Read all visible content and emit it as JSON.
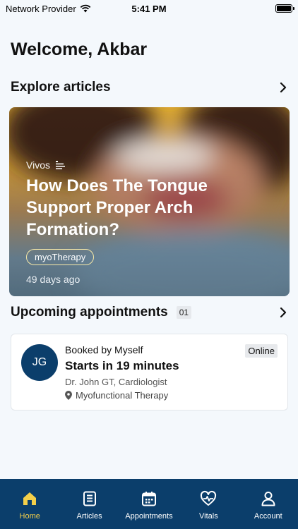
{
  "status_bar": {
    "carrier": "Network Provider",
    "time": "5:41 PM"
  },
  "welcome": "Welcome, Akbar",
  "articles_section": {
    "title": "Explore articles",
    "featured": {
      "source": "Vivos",
      "title": "How Does The Tongue Support Proper Arch Formation?",
      "tag": "myoTherapy",
      "age": "49 days ago"
    }
  },
  "appointments_section": {
    "title": "Upcoming appointments",
    "count": "01",
    "appointment": {
      "avatar_initials": "JG",
      "booked_by": "Booked by Myself",
      "starts": "Starts in 19 minutes",
      "doctor": "Dr. John GT, Cardiologist",
      "therapy": "Myofunctional Therapy",
      "mode": "Online"
    }
  },
  "tab_bar": {
    "tabs": [
      {
        "label": "Home",
        "icon": "home-icon",
        "active": true
      },
      {
        "label": "Articles",
        "icon": "articles-icon",
        "active": false
      },
      {
        "label": "Appointments",
        "icon": "calendar-icon",
        "active": false
      },
      {
        "label": "Vitals",
        "icon": "heart-pulse-icon",
        "active": false
      },
      {
        "label": "Account",
        "icon": "person-icon",
        "active": false
      }
    ]
  },
  "colors": {
    "primary": "#0b3e6b",
    "active_tab": "#f3cf4a",
    "background": "#f4f8fc"
  }
}
